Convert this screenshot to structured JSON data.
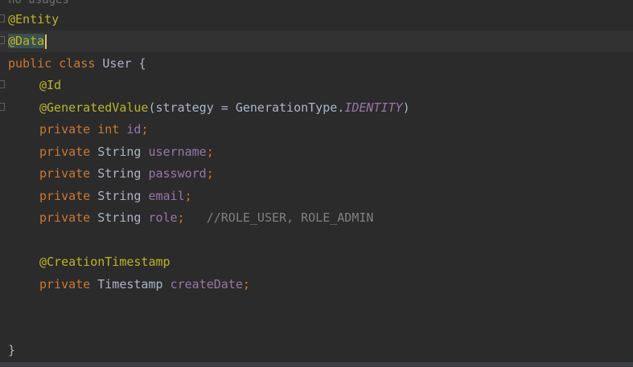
{
  "editor": {
    "usages_hint": "no usages",
    "lines": {
      "l1": {
        "ann": "@Entity"
      },
      "l2": {
        "ann": "@Data"
      },
      "l3": {
        "kw": "public class ",
        "name": "User",
        "rest": " {"
      },
      "l4": {
        "ann": "@Id"
      },
      "l5": {
        "ann": "@GeneratedValue",
        "open": "(strategy = GenerationType.",
        "const": "IDENTITY",
        "close": ")"
      },
      "l6": {
        "kw": "private int ",
        "field": "id",
        "semi": ";"
      },
      "l7": {
        "kw": "private ",
        "type": "String ",
        "field": "username",
        "semi": ";"
      },
      "l8": {
        "kw": "private ",
        "type": "String ",
        "field": "password",
        "semi": ";"
      },
      "l9": {
        "kw": "private ",
        "type": "String ",
        "field": "email",
        "semi": ";"
      },
      "l10": {
        "kw": "private ",
        "type": "String ",
        "field": "role",
        "semi": ";",
        "comment": "   //ROLE_USER, ROLE_ADMIN"
      },
      "l12": {
        "ann": "@CreationTimestamp"
      },
      "l13": {
        "kw": "private ",
        "type": "Timestamp ",
        "field": "createDate",
        "semi": ";"
      },
      "l16": {
        "brace": "}"
      }
    },
    "colors": {
      "background": "#2b2b2b",
      "annotation": "#bbb529",
      "keyword": "#cc7832",
      "field": "#9876aa",
      "comment": "#808080",
      "text": "#a9b7c6"
    }
  }
}
